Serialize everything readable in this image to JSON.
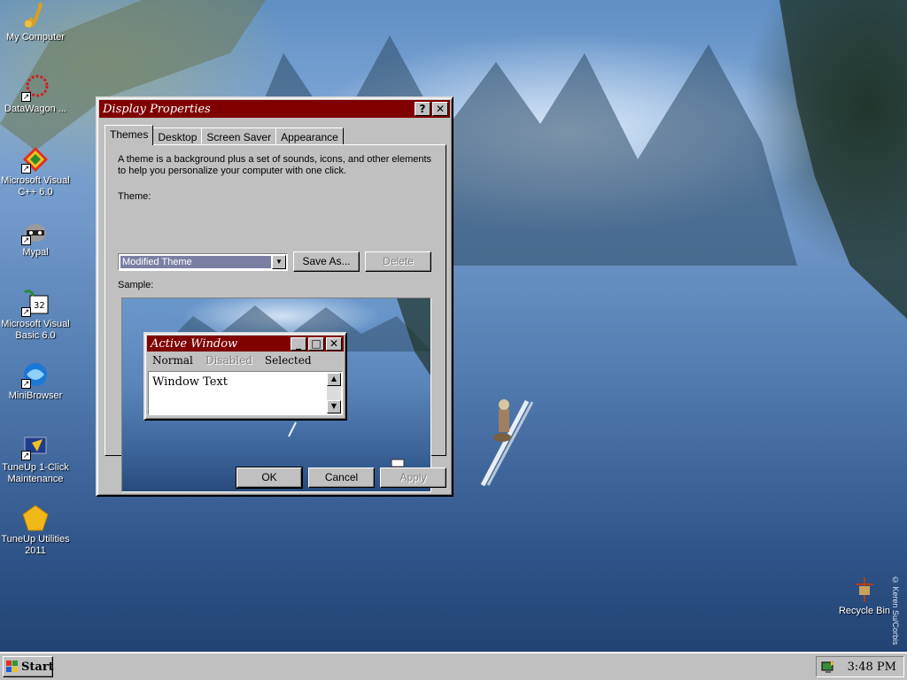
{
  "desktop": {
    "icons": [
      {
        "label": "My Computer",
        "icon": "saxophone-icon",
        "shortcut": false
      },
      {
        "label": "DataWagon ...",
        "icon": "datawagon-icon",
        "shortcut": true
      },
      {
        "label": "Microsoft Visual C++ 6.0",
        "icon": "visual-cpp-icon",
        "shortcut": true
      },
      {
        "label": "Mypal",
        "icon": "raccoon-icon",
        "shortcut": true
      },
      {
        "label": "Microsoft Visual Basic 6.0",
        "icon": "visual-basic-icon",
        "shortcut": true
      },
      {
        "label": "MiniBrowser",
        "icon": "minibrowser-icon",
        "shortcut": true
      },
      {
        "label": "TuneUp 1-Click Maintenance",
        "icon": "tuneup-maintenance-icon",
        "shortcut": true
      },
      {
        "label": "TuneUp Utilities 2011",
        "icon": "tuneup-utilities-icon",
        "shortcut": false
      }
    ],
    "recycle_bin": {
      "label": "Recycle Bin",
      "icon": "recycle-bin-icon"
    },
    "wallpaper_credit": "© Keren Su/Corbis"
  },
  "dialog": {
    "title": "Display Properties",
    "help_button": "?",
    "close_button": "✕",
    "tabs": [
      "Themes",
      "Desktop",
      "Screen Saver",
      "Appearance"
    ],
    "active_tab": "Themes",
    "description": "A theme is a background plus a set of sounds, icons, and other elements to help you personalize your computer with one click.",
    "theme_label": "Theme:",
    "theme_value": "Modified Theme",
    "save_as_button": "Save As...",
    "delete_button": "Delete",
    "sample_label": "Sample:",
    "ok_button": "OK",
    "cancel_button": "Cancel",
    "apply_button": "Apply"
  },
  "sample_window": {
    "title": "Active Window",
    "menu": [
      "Normal",
      "Disabled",
      "Selected"
    ],
    "text": "Window Text"
  },
  "taskbar": {
    "start_label": "Start",
    "clock": "3:48 PM"
  },
  "colors": {
    "title_bar": "#800000",
    "face": "#c0c0c0",
    "combo_highlight": "#7b7fa3"
  }
}
